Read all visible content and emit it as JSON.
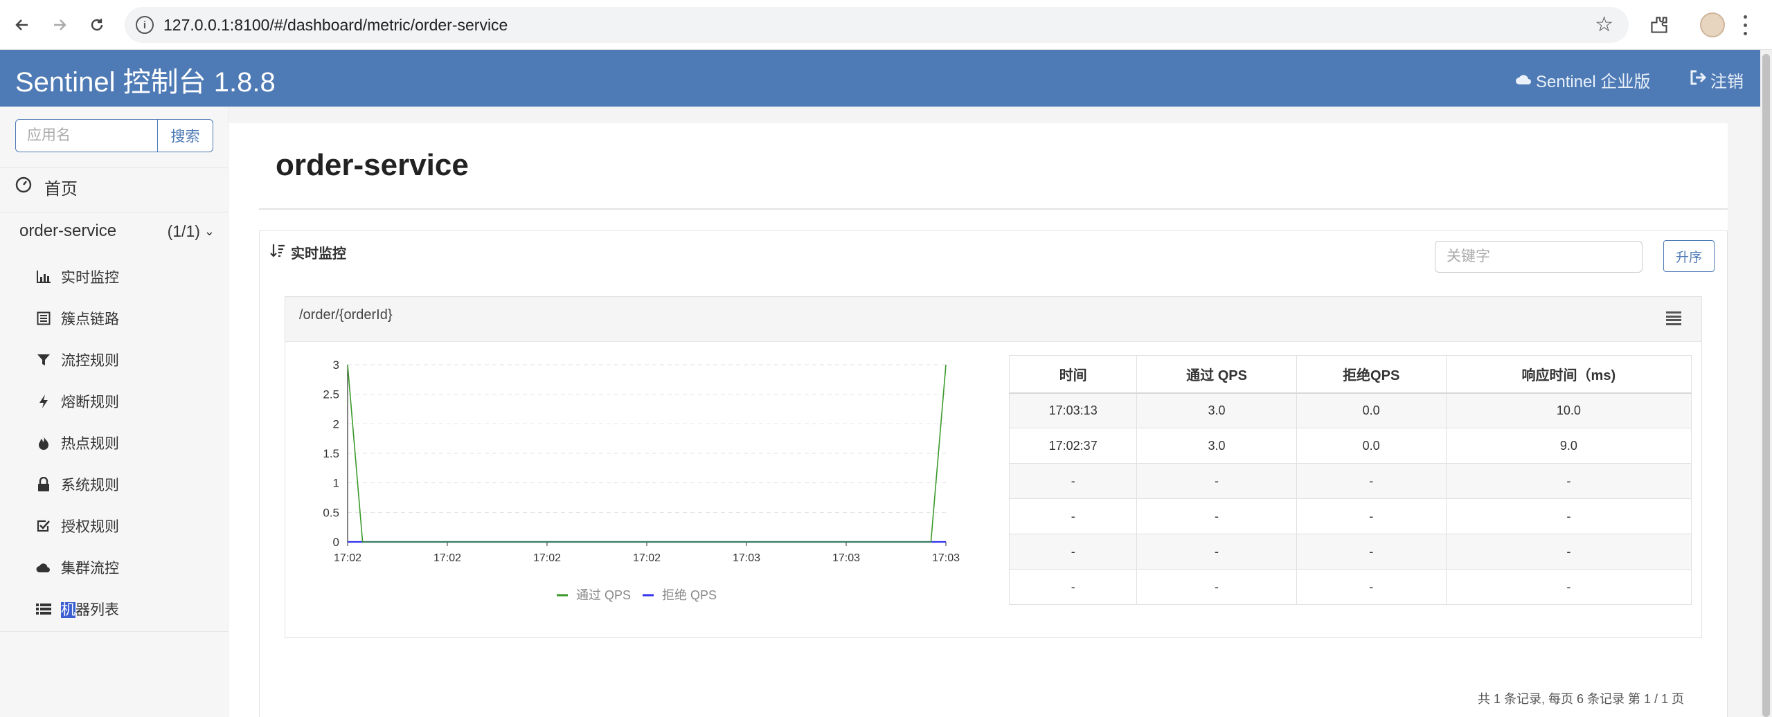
{
  "browser": {
    "url": "127.0.0.1:8100/#/dashboard/metric/order-service"
  },
  "header": {
    "title": "Sentinel 控制台 1.8.8",
    "enterprise_label": "Sentinel 企业版",
    "logout_label": "注销"
  },
  "sidebar": {
    "search_placeholder": "应用名",
    "search_button": "搜索",
    "home_label": "首页",
    "app_name": "order-service",
    "app_count": "(1/1)",
    "items": [
      {
        "label": "实时监控",
        "icon": "bar-chart-icon"
      },
      {
        "label": "簇点链路",
        "icon": "list-alt-icon"
      },
      {
        "label": "流控规则",
        "icon": "filter-icon"
      },
      {
        "label": "熔断规则",
        "icon": "flash-icon"
      },
      {
        "label": "热点规则",
        "icon": "fire-icon"
      },
      {
        "label": "系统规则",
        "icon": "lock-icon"
      },
      {
        "label": "授权规则",
        "icon": "check-square-icon"
      },
      {
        "label": "集群流控",
        "icon": "cloud-icon"
      },
      {
        "label_highlight": "机",
        "label_rest": "器列表",
        "icon": "list-icon"
      }
    ]
  },
  "main": {
    "page_title": "order-service",
    "monitor_label": "实时监控",
    "keyword_placeholder": "关键字",
    "sort_button": "升序",
    "resource_name": "/order/{orderId}",
    "table": {
      "headers": [
        "时间",
        "通过 QPS",
        "拒绝QPS",
        "响应时间（ms)"
      ],
      "rows": [
        [
          "17:03:13",
          "3.0",
          "0.0",
          "10.0"
        ],
        [
          "17:02:37",
          "3.0",
          "0.0",
          "9.0"
        ],
        [
          "-",
          "-",
          "-",
          "-"
        ],
        [
          "-",
          "-",
          "-",
          "-"
        ],
        [
          "-",
          "-",
          "-",
          "-"
        ],
        [
          "-",
          "-",
          "-",
          "-"
        ]
      ]
    },
    "pager": "共 1 条记录, 每页 6 条记录 第 1 / 1 页"
  },
  "chart_data": {
    "type": "line",
    "x": [
      "17:02",
      "17:02",
      "17:02",
      "17:02",
      "17:03",
      "17:03",
      "17:03"
    ],
    "ylim": [
      0,
      3
    ],
    "yticks": [
      "3",
      "2.5",
      "2",
      "1.5",
      "1",
      "0.5",
      "0"
    ],
    "series": [
      {
        "name": "通过 QPS",
        "color": "#3a9a2a",
        "points": [
          [
            0,
            3
          ],
          [
            0.025,
            0
          ],
          [
            0.975,
            0
          ],
          [
            1,
            3
          ]
        ]
      },
      {
        "name": "拒绝 QPS",
        "color": "#3333ee",
        "points": [
          [
            0,
            0
          ],
          [
            1,
            0
          ]
        ]
      }
    ],
    "grid": true,
    "legend": "bottom"
  }
}
